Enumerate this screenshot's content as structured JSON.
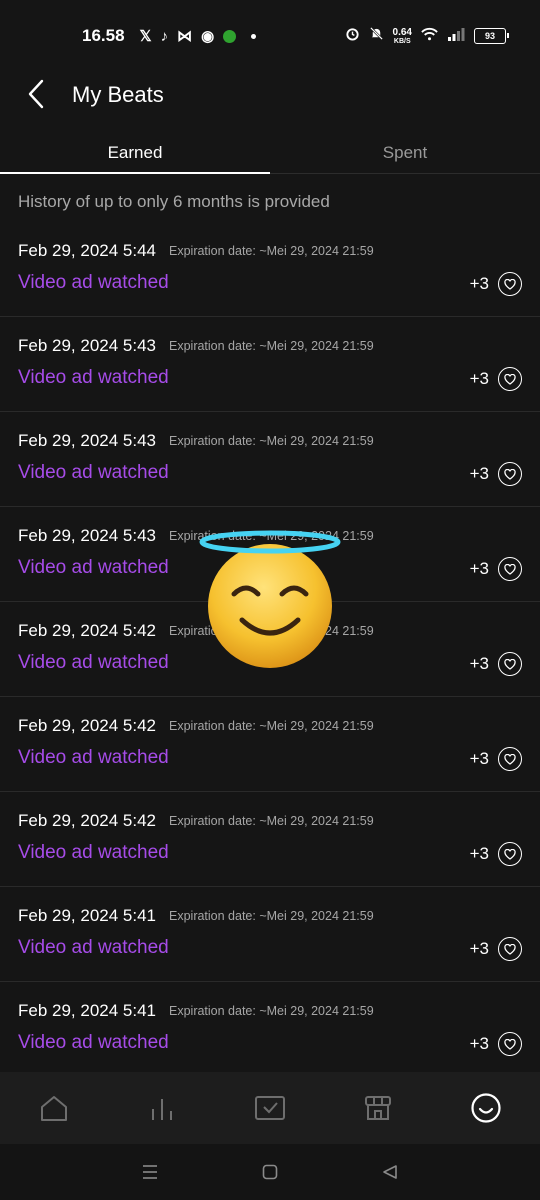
{
  "status_bar": {
    "time": "16.58",
    "net_speed": "0.64",
    "net_unit": "KB/S",
    "battery": "93",
    "icons": [
      "x-icon",
      "tiktok-icon",
      "capcut-icon",
      "app-icon",
      "green-app-icon",
      "dot-icon",
      "alarm-icon",
      "mute-icon",
      "wifi-icon",
      "signal-icon",
      "battery-icon"
    ]
  },
  "header": {
    "title": "My Beats"
  },
  "tabs": [
    {
      "label": "Earned",
      "active": true
    },
    {
      "label": "Spent",
      "active": false
    }
  ],
  "note": "History of up to only 6 months is provided",
  "entries": [
    {
      "date": "Feb 29, 2024 5:44",
      "expiration": "Expiration date: ~Mei 29, 2024 21:59",
      "desc": "Video ad watched",
      "amount": "+3"
    },
    {
      "date": "Feb 29, 2024 5:43",
      "expiration": "Expiration date: ~Mei 29, 2024 21:59",
      "desc": "Video ad watched",
      "amount": "+3"
    },
    {
      "date": "Feb 29, 2024 5:43",
      "expiration": "Expiration date: ~Mei 29, 2024 21:59",
      "desc": "Video ad watched",
      "amount": "+3"
    },
    {
      "date": "Feb 29, 2024 5:43",
      "expiration": "Expiration date: ~Mei 29, 2024 21:59",
      "desc": "Video ad watched",
      "amount": "+3"
    },
    {
      "date": "Feb 29, 2024 5:42",
      "expiration": "Expiration date: ~Mei 29, 2024 21:59",
      "desc": "Video ad watched",
      "amount": "+3"
    },
    {
      "date": "Feb 29, 2024 5:42",
      "expiration": "Expiration date: ~Mei 29, 2024 21:59",
      "desc": "Video ad watched",
      "amount": "+3"
    },
    {
      "date": "Feb 29, 2024 5:42",
      "expiration": "Expiration date: ~Mei 29, 2024 21:59",
      "desc": "Video ad watched",
      "amount": "+3"
    },
    {
      "date": "Feb 29, 2024 5:41",
      "expiration": "Expiration date: ~Mei 29, 2024 21:59",
      "desc": "Video ad watched",
      "amount": "+3"
    },
    {
      "date": "Feb 29, 2024 5:41",
      "expiration": "Expiration date: ~Mei 29, 2024 21:59",
      "desc": "Video ad watched",
      "amount": "+3"
    }
  ],
  "colors": {
    "accent": "#a64ce8",
    "background": "#151515",
    "nav_background": "#1d1d1d"
  },
  "bottom_nav": [
    "home-icon",
    "charts-icon",
    "library-icon",
    "store-icon",
    "profile-icon"
  ]
}
